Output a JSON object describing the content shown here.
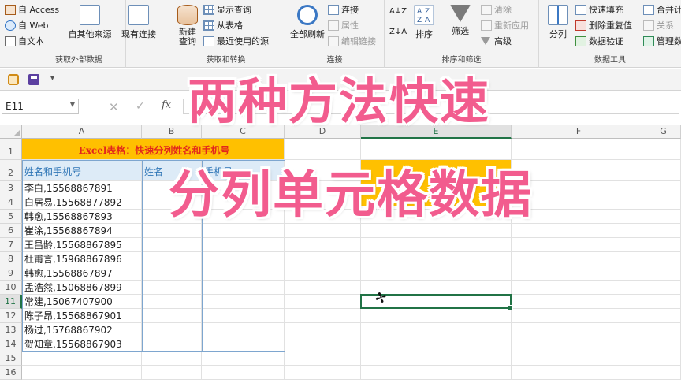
{
  "ribbon": {
    "get_external_data": {
      "group_label": "获取外部数据",
      "from_access": "自 Access",
      "from_web": "自 Web",
      "from_text": "自文本",
      "other_sources": "自其他来源",
      "existing_connections": "现有连接"
    },
    "get_transform": {
      "group_label": "获取和转换",
      "new_query": "新建\n查询",
      "show_queries": "显示查询",
      "from_table": "从表格",
      "recent_sources": "最近使用的源"
    },
    "connections": {
      "group_label": "连接",
      "refresh_all": "全部刷新",
      "connections": "连接",
      "properties": "属性",
      "edit_links": "编辑链接"
    },
    "sort_filter": {
      "group_label": "排序和筛选",
      "sort_az": "A↓Z",
      "sort_za": "Z↓A",
      "sort": "排序",
      "filter": "筛选",
      "clear": "清除",
      "reapply": "重新应用",
      "advanced": "高级"
    },
    "data_tools": {
      "group_label": "数据工具",
      "text_to_columns": "分列",
      "flash_fill": "快速填充",
      "remove_duplicates": "删除重复值",
      "data_validation": "数据验证",
      "consolidate": "合并计",
      "relationships": "关系",
      "manage_data_model": "管理数"
    }
  },
  "formula_bar": {
    "name_box": "E11",
    "cancel": "✕",
    "enter": "✓",
    "fx": "fx",
    "content": ""
  },
  "sheet": {
    "columns": [
      "A",
      "B",
      "C",
      "D",
      "E",
      "F",
      "G"
    ],
    "rows": [
      "1",
      "2",
      "3",
      "4",
      "5",
      "6",
      "7",
      "8",
      "9",
      "10",
      "11",
      "12",
      "13",
      "14",
      "15",
      "16"
    ],
    "title": "Excel表格：快速分列姓名和手机号",
    "header_a": "姓名和手机号",
    "header_b": "姓名",
    "header_c": "手机号",
    "entries": [
      "李白,15568867891",
      "白居易,15568877892",
      "韩愈,15568867893",
      "崔涂,15568867894",
      "王昌龄,15568867895",
      "杜甫言,15968867896",
      "韩愈,15568867897",
      "孟浩然,15068867899",
      "常建,15067407900",
      "陈子昂,15568867901",
      "杨过,15768867902",
      "贺知章,15568867903"
    ],
    "selected_cell": "E11"
  },
  "overlay": {
    "line1": "两种方法快速",
    "line2": "分列单元格数据"
  },
  "colors": {
    "excel_green": "#217346",
    "title_fill": "#ffc000",
    "title_text": "#e2261c",
    "header_fill": "#ddebf7",
    "header_text": "#2e75b6",
    "overlay_text": "#f25c8e"
  }
}
